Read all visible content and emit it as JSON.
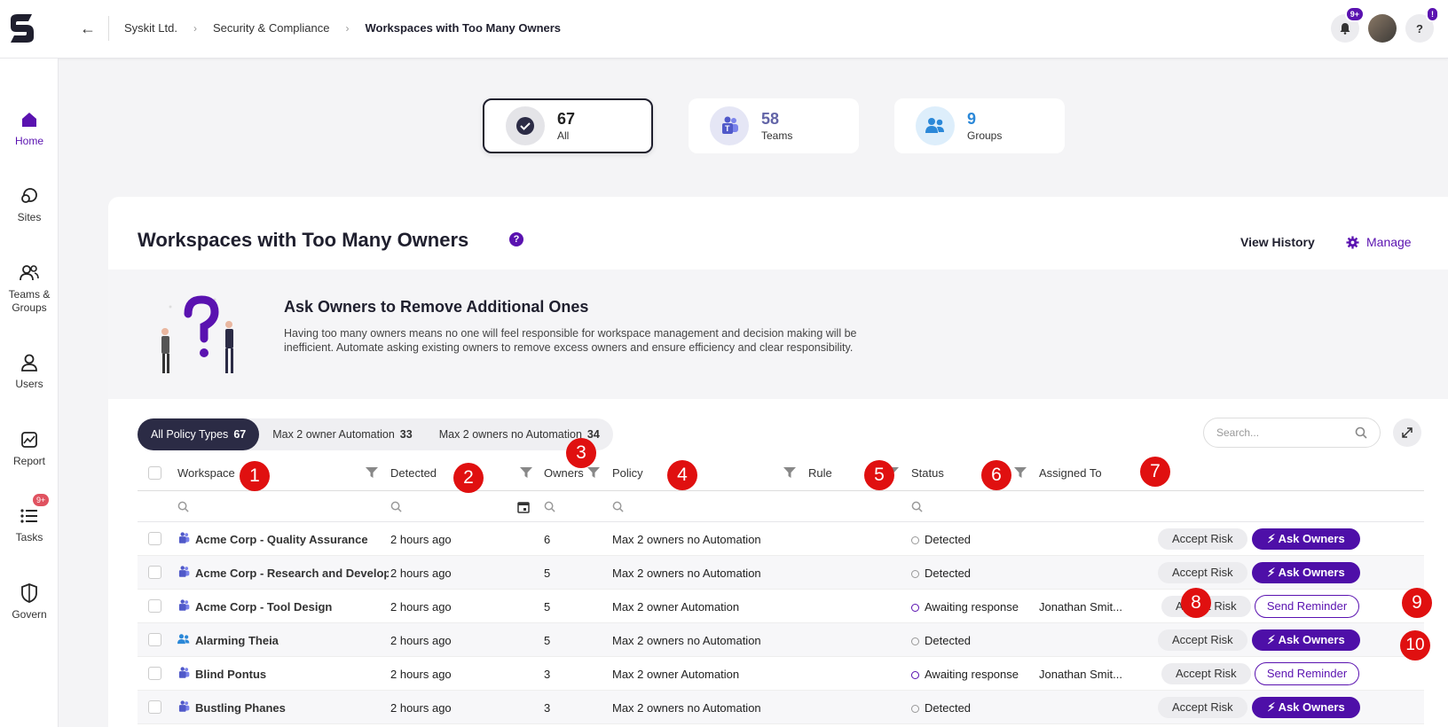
{
  "breadcrumb": [
    "Syskit Ltd.",
    "Security & Compliance",
    "Workspaces with Too Many Owners"
  ],
  "notifications_badge": "9+",
  "help_label": "?",
  "help_badge": "!",
  "sidebar": [
    {
      "label": "Home",
      "icon": "home-icon",
      "active": true
    },
    {
      "label": "Sites",
      "icon": "sites-icon"
    },
    {
      "label": "Teams &\nGroups",
      "icon": "teams-groups-icon"
    },
    {
      "label": "Users",
      "icon": "user-icon"
    },
    {
      "label": "Report",
      "icon": "report-icon"
    },
    {
      "label": "Tasks",
      "icon": "tasks-icon",
      "badge": "9+"
    },
    {
      "label": "Govern",
      "icon": "shield-icon"
    }
  ],
  "type_cards": [
    {
      "count": "67",
      "label": "All",
      "selected": true
    },
    {
      "count": "58",
      "label": "Teams",
      "color": "#6264a7"
    },
    {
      "count": "9",
      "label": "Groups",
      "color": "#2b88d8"
    }
  ],
  "page": {
    "title": "Workspaces with Too Many Owners",
    "help": "?",
    "view_history": "View History",
    "manage": "Manage"
  },
  "banner": {
    "title": "Ask Owners to Remove Additional Ones",
    "text": "Having too many owners means no one will feel responsible for workspace management and decision making will be inefficient. Automate asking existing owners to remove excess owners and ensure efficiency and clear responsibility."
  },
  "filters": [
    {
      "label": "All Policy Types",
      "count": "67",
      "active": true
    },
    {
      "label": "Max 2 owner Automation",
      "count": "33"
    },
    {
      "label": "Max 2 owners no Automation",
      "count": "34"
    }
  ],
  "search_placeholder": "Search...",
  "columns": [
    "Workspace",
    "Detected",
    "Owners",
    "Policy",
    "Rule",
    "Status",
    "Assigned To"
  ],
  "actions": {
    "accept": "Accept Risk",
    "ask": "Ask Owners",
    "remind": "Send Reminder"
  },
  "rows": [
    {
      "workspace": "Acme Corp - Quality Assurance",
      "type": "team",
      "detected": "2 hours ago",
      "owners": "6",
      "policy": "Max 2 owners no Automation",
      "status": "Detected",
      "assigned": "",
      "action": "ask"
    },
    {
      "workspace": "Acme Corp - Research and Development",
      "type": "team",
      "detected": "2 hours ago",
      "owners": "5",
      "policy": "Max 2 owners no Automation",
      "status": "Detected",
      "assigned": "",
      "action": "ask"
    },
    {
      "workspace": "Acme Corp - Tool Design",
      "type": "team",
      "detected": "2 hours ago",
      "owners": "5",
      "policy": "Max 2 owner Automation",
      "status": "Awaiting response",
      "assigned": "Jonathan Smit...",
      "action": "remind"
    },
    {
      "workspace": "Alarming Theia",
      "type": "group",
      "detected": "2 hours ago",
      "owners": "5",
      "policy": "Max 2 owners no Automation",
      "status": "Detected",
      "assigned": "",
      "action": "ask"
    },
    {
      "workspace": "Blind Pontus",
      "type": "team",
      "detected": "2 hours ago",
      "owners": "3",
      "policy": "Max 2 owner Automation",
      "status": "Awaiting response",
      "assigned": "Jonathan Smit...",
      "action": "remind"
    },
    {
      "workspace": "Bustling Phanes",
      "type": "team",
      "detected": "2 hours ago",
      "owners": "3",
      "policy": "Max 2 owners no Automation",
      "status": "Detected",
      "assigned": "",
      "action": "ask"
    }
  ],
  "markers": [
    "1",
    "2",
    "3",
    "4",
    "5",
    "6",
    "7",
    "8",
    "9",
    "10"
  ],
  "colors": {
    "accent": "#5a12b0",
    "button": "#4e0fa8",
    "marker": "#e01010"
  }
}
